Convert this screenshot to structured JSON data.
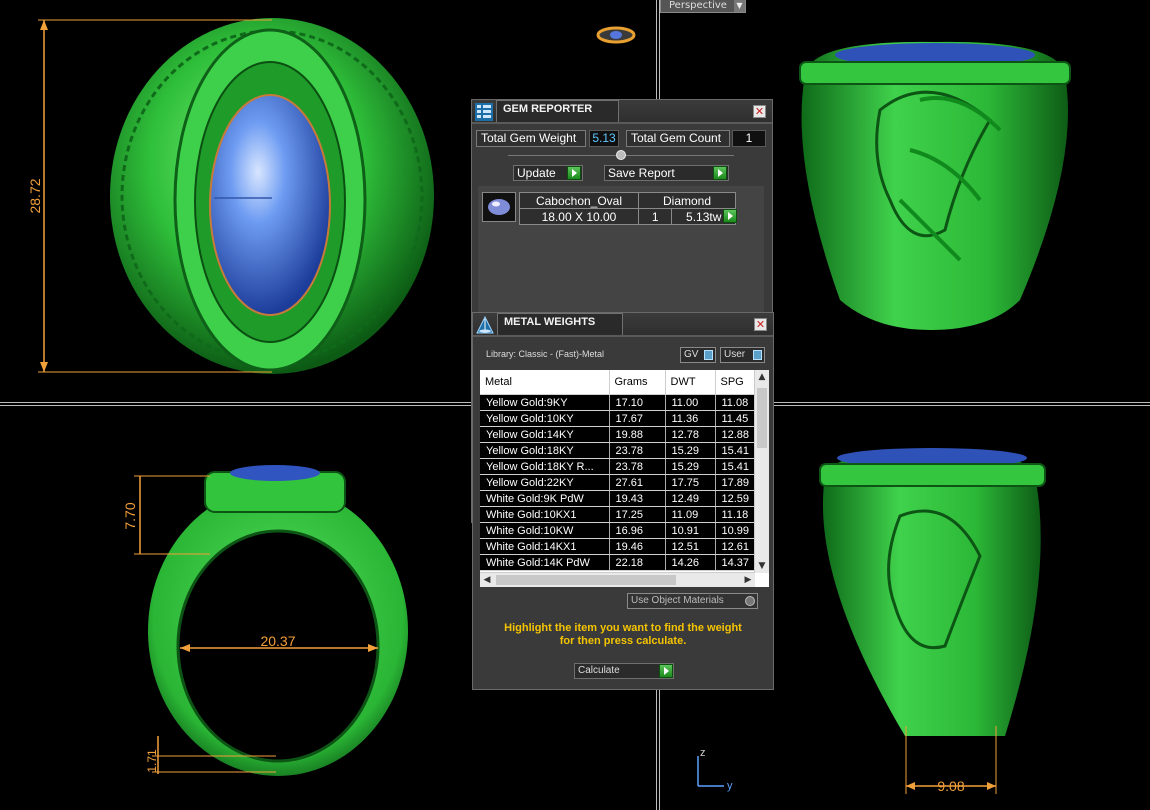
{
  "viewport": {
    "mode_label": "Perspective",
    "dims": {
      "top_left_height": "28.72",
      "bottom_left_top": "7.70",
      "bottom_left_inner": "20.37",
      "bottom_left_band": "1.71",
      "bottom_right_width": "9.08"
    },
    "axis": {
      "z": "z",
      "y": "y"
    }
  },
  "gem_reporter": {
    "title": "GEM REPORTER",
    "total_weight_label": "Total Gem Weight",
    "total_weight_value": "5.13",
    "total_count_label": "Total Gem Count",
    "total_count_value": "1",
    "update_label": "Update",
    "save_report_label": "Save Report",
    "gem": {
      "shape": "Cabochon_Oval",
      "material": "Diamond",
      "size": "18.00 X 10.00",
      "count": "1",
      "weight": "5.13tw"
    }
  },
  "metal_weights": {
    "title": "METAL WEIGHTS",
    "library": "Library: Classic - (Fast)-Metal",
    "gv_label": "GV",
    "user_label": "User",
    "columns": [
      "Metal",
      "Grams",
      "DWT",
      "SPG"
    ],
    "rows": [
      [
        "Yellow Gold:9KY",
        "17.10",
        "11.00",
        "11.08"
      ],
      [
        "Yellow Gold:10KY",
        "17.67",
        "11.36",
        "11.45"
      ],
      [
        "Yellow Gold:14KY",
        "19.88",
        "12.78",
        "12.88"
      ],
      [
        "Yellow Gold:18KY",
        "23.78",
        "15.29",
        "15.41"
      ],
      [
        "Yellow Gold:18KY R...",
        "23.78",
        "15.29",
        "15.41"
      ],
      [
        "Yellow Gold:22KY",
        "27.61",
        "17.75",
        "17.89"
      ],
      [
        "White Gold:9K PdW",
        "19.43",
        "12.49",
        "12.59"
      ],
      [
        "White Gold:10KX1",
        "17.25",
        "11.09",
        "11.18"
      ],
      [
        "White Gold:10KW",
        "16.96",
        "10.91",
        "10.99"
      ],
      [
        "White Gold:14KX1",
        "19.46",
        "12.51",
        "12.61"
      ],
      [
        "White Gold:14K PdW",
        "22.18",
        "14.26",
        "14.37"
      ]
    ],
    "use_object_materials_label": "Use Object Materials",
    "hint_line1": "Highlight the item you want to find the weight",
    "hint_line2": "for then press calculate.",
    "calculate_label": "Calculate"
  },
  "colors": {
    "ring_green": "#2fbf3a",
    "gem_blue": "#4f7fe0",
    "dimension_orange": "#f2a03a",
    "hint_yellow": "#f5c400"
  }
}
